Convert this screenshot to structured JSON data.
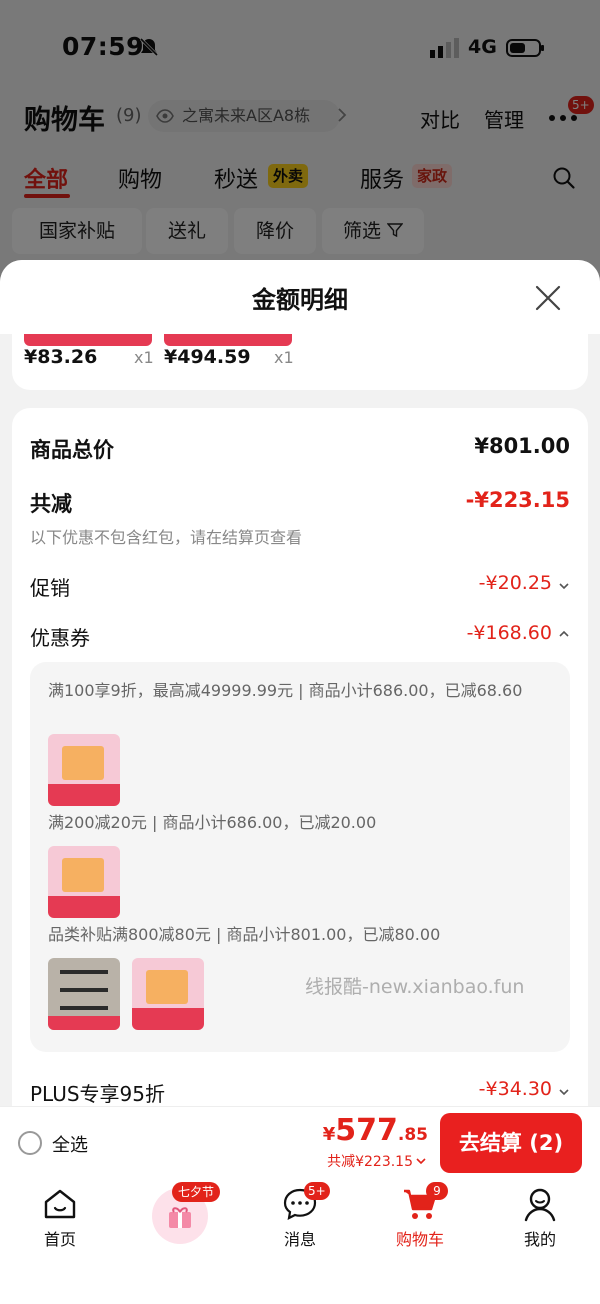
{
  "status_bar": {
    "time": "07:59",
    "network": "4G"
  },
  "cart_header": {
    "title": "购物车",
    "count": "(9)",
    "address": "之寓未来A区A8栋",
    "compare_label": "对比",
    "manage_label": "管理",
    "more_badge": "5+"
  },
  "category_tabs": {
    "all": "全部",
    "shopping": "购物",
    "flash": "秒送",
    "flash_tag": "外卖",
    "service": "服务",
    "service_tag": "家政"
  },
  "filters": [
    "国家补贴",
    "送礼",
    "降价",
    "筛选"
  ],
  "sheet": {
    "title": "金额明细",
    "items": [
      {
        "price": "¥83.26",
        "qty": "x1"
      },
      {
        "price": "¥494.59",
        "qty": "x1"
      }
    ],
    "detail": {
      "total_label": "商品总价",
      "total_value": "¥801.00",
      "discount_label": "共减",
      "discount_value": "-¥223.15",
      "note": "以下优惠不包含红包，请在结算页查看",
      "promo_label": "促销",
      "promo_value": "-¥20.25",
      "coupon_label": "优惠券",
      "coupon_value": "-¥168.60",
      "coupons": [
        "满100享9折，最高减49999.99元 | 商品小计686.00，已减68.60",
        "满200减20元 | 商品小计686.00，已减20.00",
        "品类补贴满800减80元 | 商品小计801.00，已减80.00"
      ],
      "plus_label": "PLUS专享95折",
      "plus_value": "-¥34.30"
    }
  },
  "watermark": "线报酷-new.xianbao.fun",
  "checkout": {
    "select_all": "全选",
    "yen": "¥",
    "total_int": "577",
    "total_dec": ".85",
    "discount_summary": "共减¥223.15",
    "button_label": "去结算 (2)"
  },
  "tab_bar": {
    "home": "首页",
    "promo_tag": "七夕节",
    "messages": "消息",
    "messages_badge": "5+",
    "cart": "购物车",
    "cart_badge": "9",
    "mine": "我的"
  },
  "colors": {
    "accent": "#e2231a",
    "button": "#e9201f",
    "overlay": "rgba(0,0,0,0.5)"
  }
}
